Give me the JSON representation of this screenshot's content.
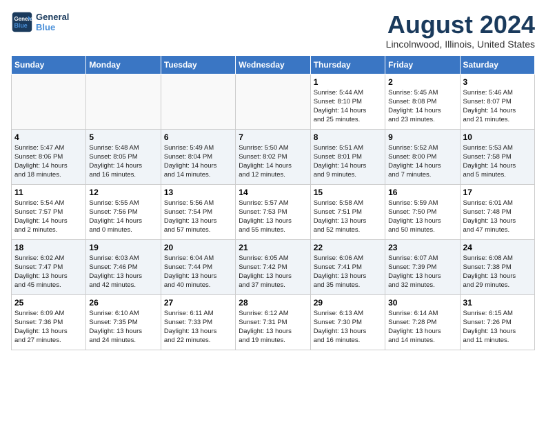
{
  "header": {
    "logo_line1": "General",
    "logo_line2": "Blue",
    "title": "August 2024",
    "subtitle": "Lincolnwood, Illinois, United States"
  },
  "days_of_week": [
    "Sunday",
    "Monday",
    "Tuesday",
    "Wednesday",
    "Thursday",
    "Friday",
    "Saturday"
  ],
  "weeks": [
    [
      {
        "day": "",
        "info": ""
      },
      {
        "day": "",
        "info": ""
      },
      {
        "day": "",
        "info": ""
      },
      {
        "day": "",
        "info": ""
      },
      {
        "day": "1",
        "info": "Sunrise: 5:44 AM\nSunset: 8:10 PM\nDaylight: 14 hours\nand 25 minutes."
      },
      {
        "day": "2",
        "info": "Sunrise: 5:45 AM\nSunset: 8:08 PM\nDaylight: 14 hours\nand 23 minutes."
      },
      {
        "day": "3",
        "info": "Sunrise: 5:46 AM\nSunset: 8:07 PM\nDaylight: 14 hours\nand 21 minutes."
      }
    ],
    [
      {
        "day": "4",
        "info": "Sunrise: 5:47 AM\nSunset: 8:06 PM\nDaylight: 14 hours\nand 18 minutes."
      },
      {
        "day": "5",
        "info": "Sunrise: 5:48 AM\nSunset: 8:05 PM\nDaylight: 14 hours\nand 16 minutes."
      },
      {
        "day": "6",
        "info": "Sunrise: 5:49 AM\nSunset: 8:04 PM\nDaylight: 14 hours\nand 14 minutes."
      },
      {
        "day": "7",
        "info": "Sunrise: 5:50 AM\nSunset: 8:02 PM\nDaylight: 14 hours\nand 12 minutes."
      },
      {
        "day": "8",
        "info": "Sunrise: 5:51 AM\nSunset: 8:01 PM\nDaylight: 14 hours\nand 9 minutes."
      },
      {
        "day": "9",
        "info": "Sunrise: 5:52 AM\nSunset: 8:00 PM\nDaylight: 14 hours\nand 7 minutes."
      },
      {
        "day": "10",
        "info": "Sunrise: 5:53 AM\nSunset: 7:58 PM\nDaylight: 14 hours\nand 5 minutes."
      }
    ],
    [
      {
        "day": "11",
        "info": "Sunrise: 5:54 AM\nSunset: 7:57 PM\nDaylight: 14 hours\nand 2 minutes."
      },
      {
        "day": "12",
        "info": "Sunrise: 5:55 AM\nSunset: 7:56 PM\nDaylight: 14 hours\nand 0 minutes."
      },
      {
        "day": "13",
        "info": "Sunrise: 5:56 AM\nSunset: 7:54 PM\nDaylight: 13 hours\nand 57 minutes."
      },
      {
        "day": "14",
        "info": "Sunrise: 5:57 AM\nSunset: 7:53 PM\nDaylight: 13 hours\nand 55 minutes."
      },
      {
        "day": "15",
        "info": "Sunrise: 5:58 AM\nSunset: 7:51 PM\nDaylight: 13 hours\nand 52 minutes."
      },
      {
        "day": "16",
        "info": "Sunrise: 5:59 AM\nSunset: 7:50 PM\nDaylight: 13 hours\nand 50 minutes."
      },
      {
        "day": "17",
        "info": "Sunrise: 6:01 AM\nSunset: 7:48 PM\nDaylight: 13 hours\nand 47 minutes."
      }
    ],
    [
      {
        "day": "18",
        "info": "Sunrise: 6:02 AM\nSunset: 7:47 PM\nDaylight: 13 hours\nand 45 minutes."
      },
      {
        "day": "19",
        "info": "Sunrise: 6:03 AM\nSunset: 7:46 PM\nDaylight: 13 hours\nand 42 minutes."
      },
      {
        "day": "20",
        "info": "Sunrise: 6:04 AM\nSunset: 7:44 PM\nDaylight: 13 hours\nand 40 minutes."
      },
      {
        "day": "21",
        "info": "Sunrise: 6:05 AM\nSunset: 7:42 PM\nDaylight: 13 hours\nand 37 minutes."
      },
      {
        "day": "22",
        "info": "Sunrise: 6:06 AM\nSunset: 7:41 PM\nDaylight: 13 hours\nand 35 minutes."
      },
      {
        "day": "23",
        "info": "Sunrise: 6:07 AM\nSunset: 7:39 PM\nDaylight: 13 hours\nand 32 minutes."
      },
      {
        "day": "24",
        "info": "Sunrise: 6:08 AM\nSunset: 7:38 PM\nDaylight: 13 hours\nand 29 minutes."
      }
    ],
    [
      {
        "day": "25",
        "info": "Sunrise: 6:09 AM\nSunset: 7:36 PM\nDaylight: 13 hours\nand 27 minutes."
      },
      {
        "day": "26",
        "info": "Sunrise: 6:10 AM\nSunset: 7:35 PM\nDaylight: 13 hours\nand 24 minutes."
      },
      {
        "day": "27",
        "info": "Sunrise: 6:11 AM\nSunset: 7:33 PM\nDaylight: 13 hours\nand 22 minutes."
      },
      {
        "day": "28",
        "info": "Sunrise: 6:12 AM\nSunset: 7:31 PM\nDaylight: 13 hours\nand 19 minutes."
      },
      {
        "day": "29",
        "info": "Sunrise: 6:13 AM\nSunset: 7:30 PM\nDaylight: 13 hours\nand 16 minutes."
      },
      {
        "day": "30",
        "info": "Sunrise: 6:14 AM\nSunset: 7:28 PM\nDaylight: 13 hours\nand 14 minutes."
      },
      {
        "day": "31",
        "info": "Sunrise: 6:15 AM\nSunset: 7:26 PM\nDaylight: 13 hours\nand 11 minutes."
      }
    ]
  ]
}
